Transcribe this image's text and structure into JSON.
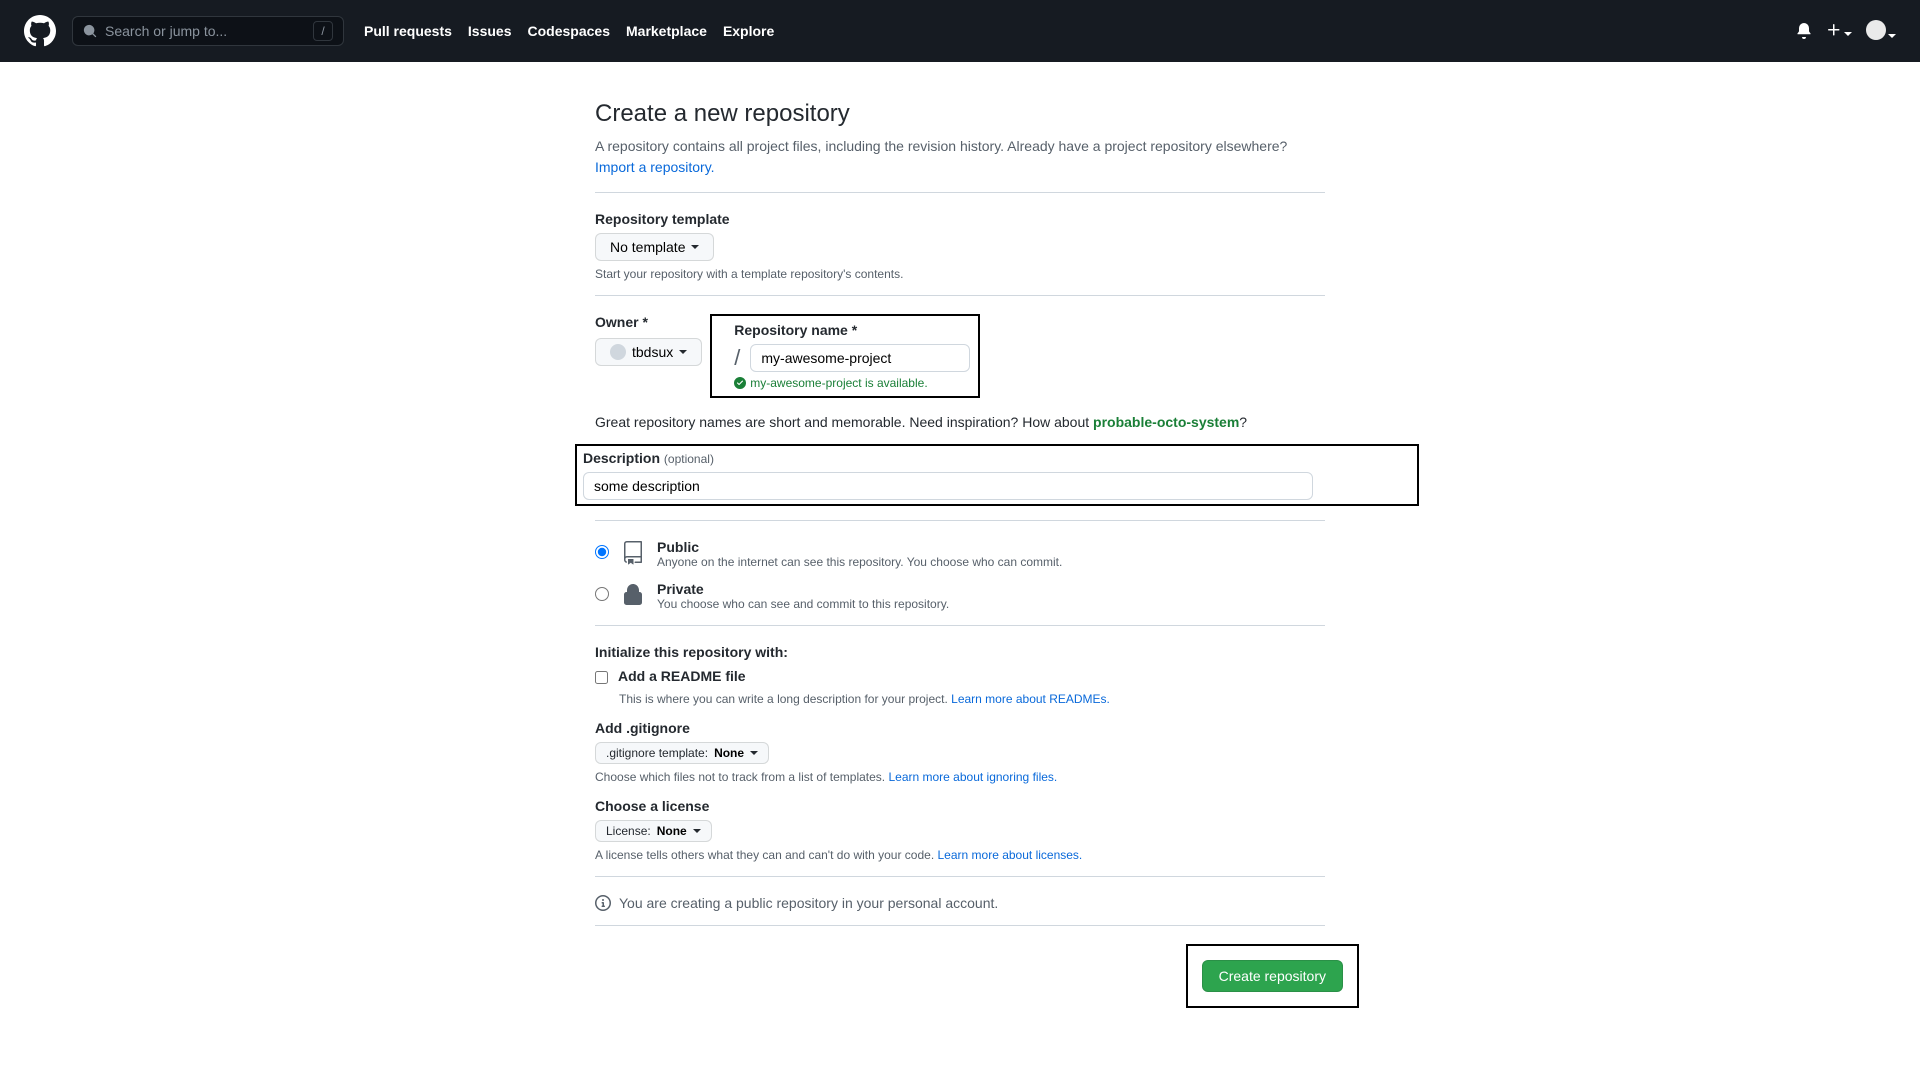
{
  "nav": {
    "search_placeholder": "Search or jump to...",
    "slash": "/",
    "links": [
      "Pull requests",
      "Issues",
      "Codespaces",
      "Marketplace",
      "Explore"
    ]
  },
  "heading": {
    "title": "Create a new repository",
    "desc": "A repository contains all project files, including the revision history. Already have a project repository elsewhere? ",
    "import_link": "Import a repository."
  },
  "template": {
    "label": "Repository template",
    "value": "No template",
    "note": "Start your repository with a template repository's contents."
  },
  "owner": {
    "label": "Owner *",
    "value": "tbdsux"
  },
  "repo_name": {
    "label": "Repository name *",
    "value": "my-awesome-project",
    "available_msg": "my-awesome-project is available."
  },
  "inspire": {
    "prefix": "Great repository names are short and memorable. Need inspiration? How about ",
    "suggestion": "probable-octo-system",
    "suffix": "?"
  },
  "description": {
    "label": "Description ",
    "optional": "(optional)",
    "value": "some description"
  },
  "visibility": {
    "public": {
      "title": "Public",
      "desc": "Anyone on the internet can see this repository. You choose who can commit."
    },
    "private": {
      "title": "Private",
      "desc": "You choose who can see and commit to this repository."
    }
  },
  "init": {
    "heading": "Initialize this repository with:",
    "readme": {
      "label": "Add a README file",
      "desc": "This is where you can write a long description for your project. ",
      "link": "Learn more about READMEs."
    },
    "gitignore": {
      "label": "Add .gitignore",
      "btn_prefix": ".gitignore template: ",
      "btn_value": "None",
      "note": "Choose which files not to track from a list of templates. ",
      "link": "Learn more about ignoring files."
    },
    "license": {
      "label": "Choose a license",
      "btn_prefix": "License: ",
      "btn_value": "None",
      "note": "A license tells others what they can and can't do with your code. ",
      "link": "Learn more about licenses."
    }
  },
  "info_msg": "You are creating a public repository in your personal account.",
  "submit_label": "Create repository"
}
